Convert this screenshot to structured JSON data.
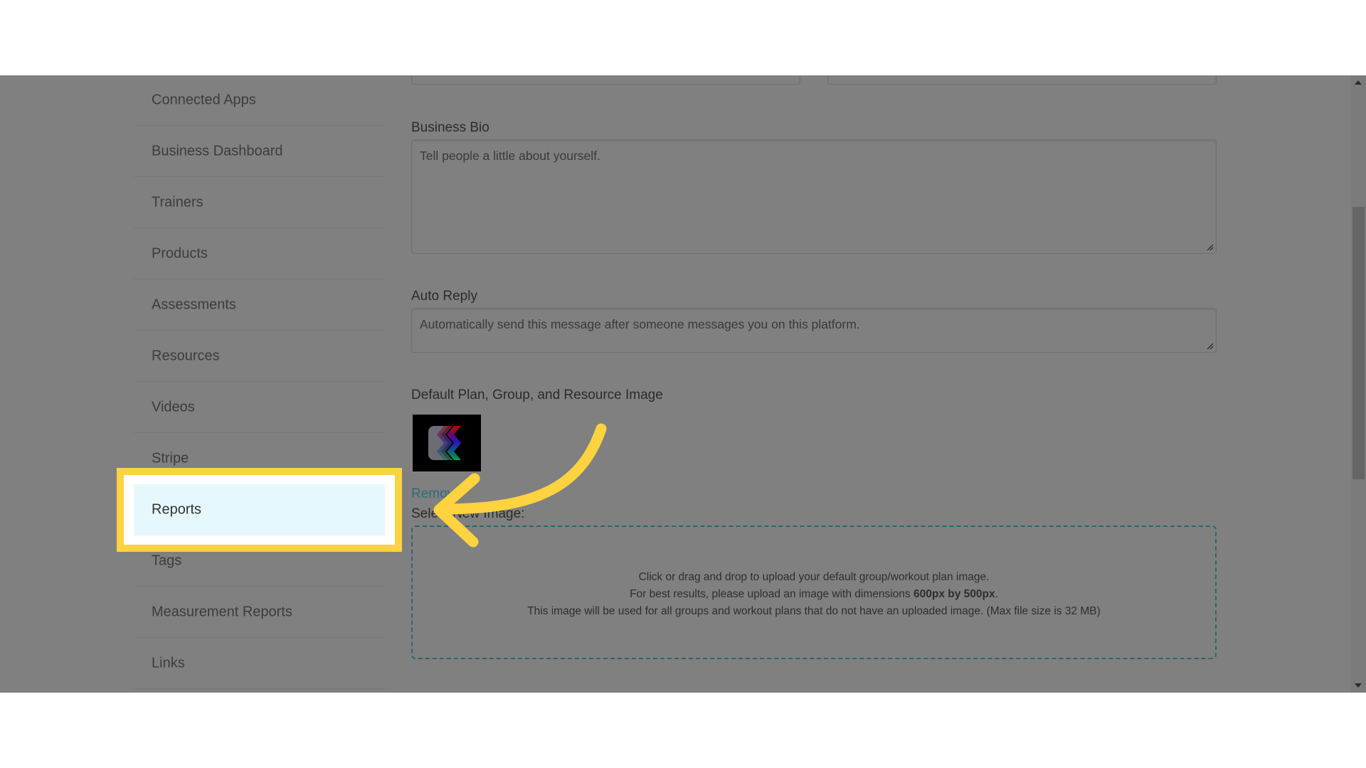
{
  "sidebar": {
    "items": [
      {
        "label": "Connected Apps"
      },
      {
        "label": "Business Dashboard"
      },
      {
        "label": "Trainers"
      },
      {
        "label": "Products"
      },
      {
        "label": "Assessments"
      },
      {
        "label": "Resources"
      },
      {
        "label": "Videos"
      },
      {
        "label": "Stripe"
      },
      {
        "label": "Reports",
        "active": true
      },
      {
        "label": "Tags"
      },
      {
        "label": "Measurement Reports"
      },
      {
        "label": "Links"
      }
    ]
  },
  "form": {
    "business_bio": {
      "label": "Business Bio",
      "placeholder": "Tell people a little about yourself."
    },
    "auto_reply": {
      "label": "Auto Reply",
      "placeholder": "Automatically send this message after someone messages you on this platform."
    },
    "default_image": {
      "label": "Default Plan, Group, and Resource Image",
      "remove_link": "Remove",
      "select_label": "Select New Image:",
      "drop_line1": "Click or drag and drop to upload your default group/workout plan image.",
      "drop_line2_prefix": "For best results, please upload an image with dimensions ",
      "drop_line2_bold": "600px by 500px",
      "drop_line2_suffix": ".",
      "drop_line3": "This image will be used for all groups and workout plans that do not have an uploaded image. (Max file size is 32 MB)"
    }
  },
  "annotation": {
    "highlight_color": "#ffd23f",
    "target": "Reports"
  },
  "colors": {
    "overlay_gray": "#808080",
    "active_item_bg": "#e6f8fb",
    "link": "#2f6b78"
  }
}
